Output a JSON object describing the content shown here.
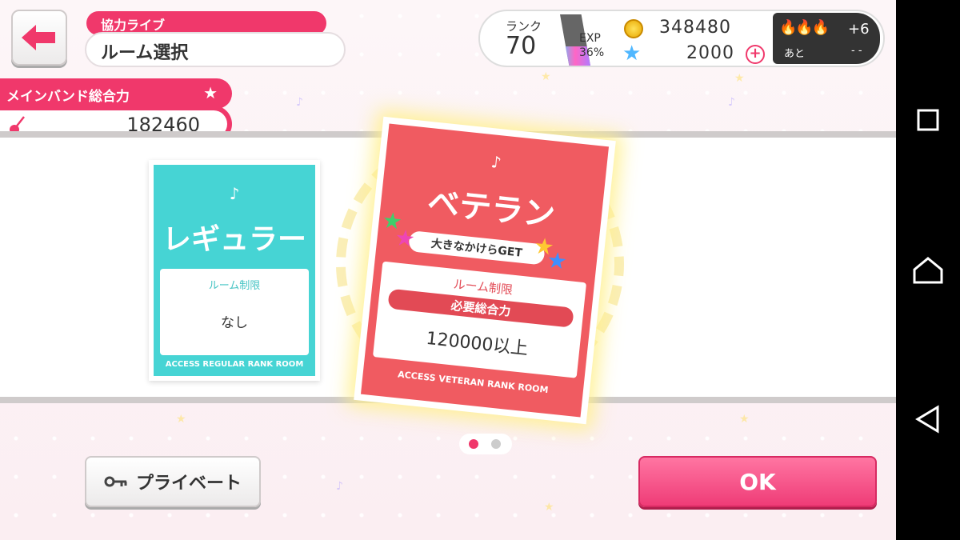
{
  "header": {
    "title_tag": "協力ライブ",
    "title": "ルーム選択"
  },
  "band_power": {
    "label": "メインバンド総合力",
    "value": "182460"
  },
  "status": {
    "rank_label": "ランク",
    "rank_value": "70",
    "exp_label": "EXP",
    "exp_percent": "36%",
    "exp_progress": 0.36,
    "coins": "348480",
    "stars": "2000",
    "boost_plus": "+6",
    "boost_next_label": "あと",
    "boost_next_value": "- -"
  },
  "cards": {
    "regular": {
      "title": "レギュラー",
      "restrict_label": "ルーム制限",
      "restrict_value": "なし",
      "access": "ACCESS REGULAR RANK ROOM"
    },
    "veteran": {
      "title": "ベテラン",
      "bonus": "大きなかけらGET",
      "restrict_label": "ルーム制限",
      "requirement_label": "必要総合力",
      "requirement_value": "120000以上",
      "access": "ACCESS VETERAN RANK ROOM"
    }
  },
  "pagination": {
    "current": 1,
    "total": 2
  },
  "buttons": {
    "private_label": "プライベート",
    "ok_label": "OK"
  },
  "colors": {
    "accent": "#f0386b",
    "regular_card": "#46d4d4",
    "veteran_card": "#f05b61"
  }
}
